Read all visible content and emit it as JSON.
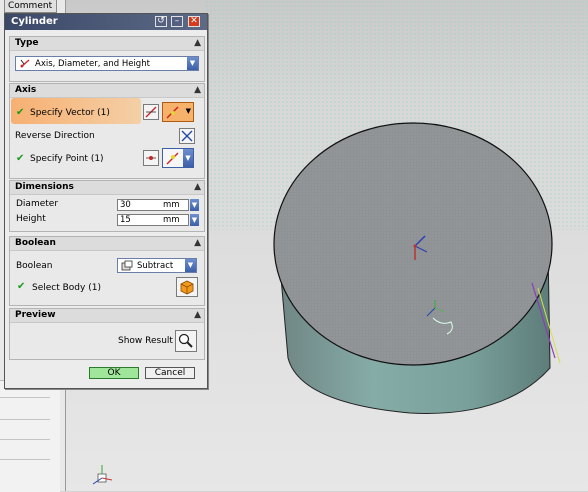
{
  "app": {
    "comment_tab": "Comment"
  },
  "dialog": {
    "title": "Cylinder",
    "sections": {
      "type": {
        "header": "Type",
        "selected": "Axis, Diameter, and Height"
      },
      "axis": {
        "header": "Axis",
        "specify_vector": "Specify Vector (1)",
        "reverse_direction": "Reverse Direction",
        "specify_point": "Specify Point (1)"
      },
      "dimensions": {
        "header": "Dimensions",
        "diameter_label": "Diameter",
        "diameter_value": "30",
        "diameter_unit": "mm",
        "height_label": "Height",
        "height_value": "15",
        "height_unit": "mm"
      },
      "boolean": {
        "header": "Boolean",
        "boolean_label": "Boolean",
        "boolean_value": "Subtract",
        "select_body": "Select Body (1)"
      },
      "preview": {
        "header": "Preview",
        "show_result": "Show Result"
      }
    },
    "ok_label": "OK",
    "cancel_label": "Cancel"
  },
  "colors": {
    "accent_highlight": "#f7b072",
    "ok_button": "#9fe69a",
    "cylinder_top": "#8f9395",
    "cylinder_side": "#7fa6a2",
    "close_button": "#d43a1c"
  }
}
